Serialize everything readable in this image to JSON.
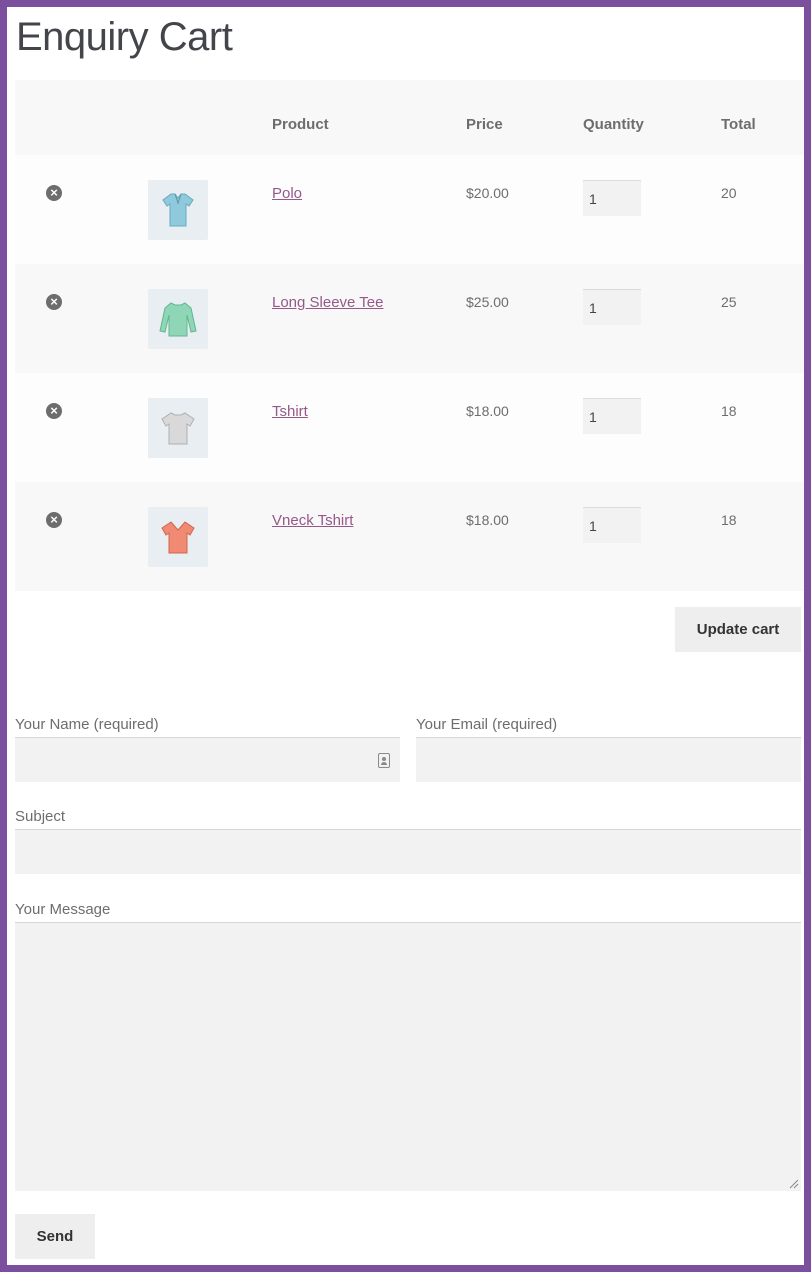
{
  "page": {
    "title": "Enquiry Cart"
  },
  "table": {
    "headers": {
      "product": "Product",
      "price": "Price",
      "quantity": "Quantity",
      "total": "Total"
    },
    "rows": [
      {
        "name": "Polo",
        "price": "$20.00",
        "qty": "1",
        "total": "20",
        "color": "#8fc9dc",
        "icon": "polo-shirt-icon"
      },
      {
        "name": "Long Sleeve Tee",
        "price": "$25.00",
        "qty": "1",
        "total": "25",
        "color": "#8fd6b6",
        "icon": "long-sleeve-tee-icon"
      },
      {
        "name": "Tshirt",
        "price": "$18.00",
        "qty": "1",
        "total": "18",
        "color": "#d4d4d4",
        "icon": "tshirt-icon"
      },
      {
        "name": "Vneck Tshirt",
        "price": "$18.00",
        "qty": "1",
        "total": "18",
        "color": "#f08a72",
        "icon": "vneck-tshirt-icon"
      }
    ]
  },
  "buttons": {
    "update_cart": "Update cart",
    "send": "Send"
  },
  "form": {
    "name_label": "Your Name (required)",
    "email_label": "Your Email (required)",
    "subject_label": "Subject",
    "message_label": "Your Message",
    "name_value": "",
    "email_value": "",
    "subject_value": "",
    "message_value": ""
  },
  "colors": {
    "accent_link": "#96588a",
    "frame": "#7b4f9d"
  }
}
